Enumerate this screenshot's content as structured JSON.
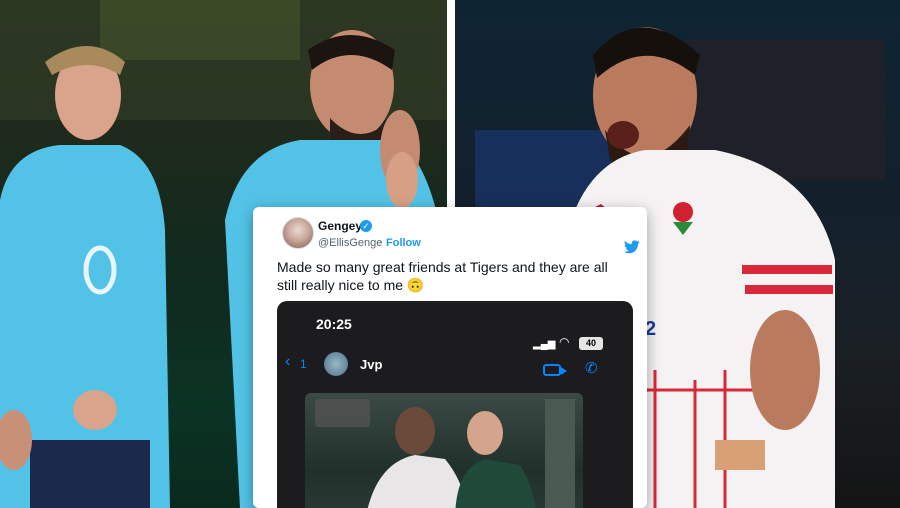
{
  "tweet": {
    "display_name": "Gengey",
    "handle": "@EllisGenge",
    "separator": "·",
    "follow_label": "Follow",
    "text": "Made so many great friends at Tigers and they are all still really nice to me 🙃",
    "verified_icon": "verified-badge-icon",
    "brand_icon": "twitter-bird-icon",
    "colors": {
      "link": "#1d9bf0",
      "text": "#0f1419",
      "secondary": "#536471"
    }
  },
  "screenshot": {
    "time": "20:25",
    "battery": "40",
    "back_count": "1",
    "contact_name": "Jvp",
    "icons": [
      "signal-icon",
      "wifi-icon",
      "battery-icon",
      "back-chevron-icon",
      "video-call-icon",
      "phone-call-icon"
    ],
    "accent": "#0a84ff"
  },
  "photos": {
    "left": "training-photo",
    "right": "match-photo"
  },
  "shirt_number": "2"
}
